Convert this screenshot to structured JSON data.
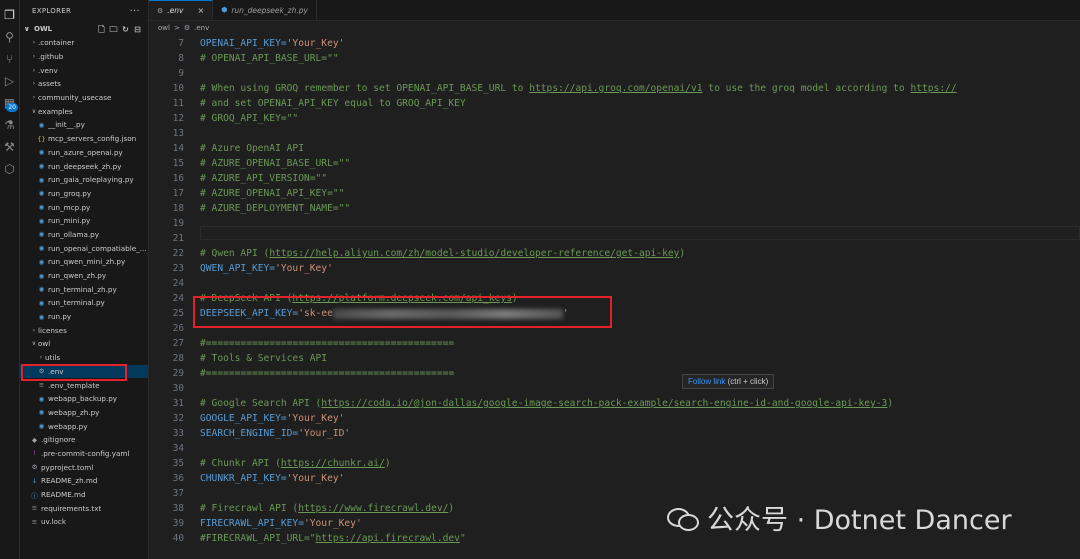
{
  "activity_bar": {
    "icons": [
      "explorer-icon",
      "search-icon",
      "source-control-icon",
      "run-debug-icon",
      "extensions-icon",
      "testing-icon",
      "remote-icon",
      "docker-icon"
    ],
    "extensions_badge": "20"
  },
  "sidebar": {
    "title": "EXPLORER",
    "more": "···",
    "root": "OWL",
    "items": [
      {
        "label": ".container",
        "type": "folder",
        "expanded": false,
        "depth": 1
      },
      {
        "label": ".github",
        "type": "folder",
        "expanded": false,
        "depth": 1
      },
      {
        "label": ".venv",
        "type": "folder",
        "expanded": false,
        "depth": 1
      },
      {
        "label": "assets",
        "type": "folder",
        "expanded": false,
        "depth": 1
      },
      {
        "label": "community_usecase",
        "type": "folder",
        "expanded": false,
        "depth": 1
      },
      {
        "label": "examples",
        "type": "folder",
        "expanded": true,
        "depth": 1
      },
      {
        "label": "__init__.py",
        "type": "py",
        "depth": 2
      },
      {
        "label": "mcp_servers_config.json",
        "type": "json",
        "depth": 2
      },
      {
        "label": "run_azure_openai.py",
        "type": "py",
        "depth": 2
      },
      {
        "label": "run_deepseek_zh.py",
        "type": "py",
        "depth": 2
      },
      {
        "label": "run_gaia_roleplaying.py",
        "type": "py",
        "depth": 2
      },
      {
        "label": "run_groq.py",
        "type": "py",
        "depth": 2
      },
      {
        "label": "run_mcp.py",
        "type": "py",
        "depth": 2
      },
      {
        "label": "run_mini.py",
        "type": "py",
        "depth": 2
      },
      {
        "label": "run_ollama.py",
        "type": "py",
        "depth": 2
      },
      {
        "label": "run_openai_compatiable_...",
        "type": "py",
        "depth": 2
      },
      {
        "label": "run_qwen_mini_zh.py",
        "type": "py",
        "depth": 2
      },
      {
        "label": "run_qwen_zh.py",
        "type": "py",
        "depth": 2
      },
      {
        "label": "run_terminal_zh.py",
        "type": "py",
        "depth": 2
      },
      {
        "label": "run_terminal.py",
        "type": "py",
        "depth": 2
      },
      {
        "label": "run.py",
        "type": "py",
        "depth": 2
      },
      {
        "label": "licenses",
        "type": "folder",
        "expanded": false,
        "depth": 1
      },
      {
        "label": "owl",
        "type": "folder",
        "expanded": true,
        "depth": 1
      },
      {
        "label": "utils",
        "type": "folder",
        "expanded": false,
        "depth": 2
      },
      {
        "label": ".env",
        "type": "gear",
        "depth": 2,
        "selected": true
      },
      {
        "label": ".env_template",
        "type": "txt",
        "depth": 2
      },
      {
        "label": "webapp_backup.py",
        "type": "py",
        "depth": 2
      },
      {
        "label": "webapp_zh.py",
        "type": "py",
        "depth": 2
      },
      {
        "label": "webapp.py",
        "type": "py",
        "depth": 2
      },
      {
        "label": ".gitignore",
        "type": "git",
        "depth": 1
      },
      {
        "label": ".pre-commit-config.yaml",
        "type": "yaml",
        "depth": 1
      },
      {
        "label": "pyproject.toml",
        "type": "toml",
        "depth": 1
      },
      {
        "label": "README_zh.md",
        "type": "md",
        "depth": 1
      },
      {
        "label": "README.md",
        "type": "info",
        "depth": 1
      },
      {
        "label": "requirements.txt",
        "type": "txt",
        "depth": 1
      },
      {
        "label": "uv.lock",
        "type": "lock",
        "depth": 1
      }
    ]
  },
  "tabs": [
    {
      "label": ".env",
      "icon": "gear-icon",
      "active": true,
      "close": "×"
    },
    {
      "label": "run_deepseek_zh.py",
      "icon": "python-file-icon",
      "active": false
    }
  ],
  "breadcrumb": {
    "root": "owl",
    "sep": ">",
    "file": ".env"
  },
  "editor": {
    "lines": [
      {
        "n": "7",
        "parts": [
          [
            "key",
            "OPENAI_API_KEY="
          ],
          [
            "str",
            "'Your_Key'"
          ]
        ]
      },
      {
        "n": "8",
        "parts": [
          [
            "comment",
            "# OPENAI_API_BASE_URL=\"\""
          ]
        ]
      },
      {
        "n": "9",
        "parts": []
      },
      {
        "n": "10",
        "parts": [
          [
            "comment",
            "# When using GROQ remember to set OPENAI_API_BASE_URL to "
          ],
          [
            "link",
            "https://api.groq.com/openai/v1"
          ],
          [
            "comment",
            " to use the groq model according to "
          ],
          [
            "link",
            "https://"
          ]
        ]
      },
      {
        "n": "11",
        "parts": [
          [
            "comment",
            "# and set OPENAI_API_KEY equal to GROQ_API_KEY"
          ]
        ]
      },
      {
        "n": "12",
        "parts": [
          [
            "comment",
            "# GROQ_API_KEY=\"\""
          ]
        ]
      },
      {
        "n": "13",
        "parts": []
      },
      {
        "n": "14",
        "parts": [
          [
            "comment",
            "# Azure OpenAI API"
          ]
        ]
      },
      {
        "n": "15",
        "parts": [
          [
            "comment",
            "# AZURE_OPENAI_BASE_URL=\"\""
          ]
        ]
      },
      {
        "n": "16",
        "parts": [
          [
            "comment",
            "# AZURE_API_VERSION=\"\""
          ]
        ]
      },
      {
        "n": "17",
        "parts": [
          [
            "comment",
            "# AZURE_OPENAI_API_KEY=\"\""
          ]
        ]
      },
      {
        "n": "18",
        "parts": [
          [
            "comment",
            "# AZURE_DEPLOYMENT_NAME=\"\""
          ]
        ]
      },
      {
        "n": "19",
        "parts": []
      },
      {
        "n": "21",
        "parts": []
      },
      {
        "n": "22",
        "parts": [
          [
            "comment",
            "# Qwen API ("
          ],
          [
            "link",
            "https://help.aliyun.com/zh/model-studio/developer-reference/get-api-key"
          ],
          [
            "comment",
            ")"
          ]
        ]
      },
      {
        "n": "23",
        "parts": [
          [
            "key",
            "QWEN_API_KEY="
          ],
          [
            "str",
            "'Your_Key'"
          ]
        ]
      },
      {
        "n": "24",
        "parts": []
      },
      {
        "n": "24",
        "parts": [
          [
            "comment",
            "# DeepSeek API ("
          ],
          [
            "link",
            "https://platform.deepseek.com/api_keys"
          ],
          [
            "comment",
            ")"
          ]
        ]
      },
      {
        "n": "25",
        "parts": [
          [
            "key",
            "DEEPSEEK_API_KEY="
          ],
          [
            "str",
            "'sk-ee"
          ],
          [
            "blur",
            ""
          ],
          [
            "str",
            "'"
          ]
        ]
      },
      {
        "n": "26",
        "parts": []
      },
      {
        "n": "27",
        "parts": [
          [
            "comment",
            "#==========================================="
          ]
        ]
      },
      {
        "n": "28",
        "parts": [
          [
            "comment",
            "# Tools & Services API"
          ]
        ]
      },
      {
        "n": "29",
        "parts": [
          [
            "comment",
            "#==========================================="
          ]
        ]
      },
      {
        "n": "30",
        "parts": []
      },
      {
        "n": "31",
        "parts": [
          [
            "comment",
            "# Google Search API ("
          ],
          [
            "link",
            "https://coda.io/@jon-dallas/google-image-search-pack-example/search-engine-id-and-google-api-key-3"
          ],
          [
            "comment",
            ")"
          ]
        ]
      },
      {
        "n": "32",
        "parts": [
          [
            "key",
            "GOOGLE_API_KEY="
          ],
          [
            "str",
            "'Your_Key'"
          ]
        ]
      },
      {
        "n": "33",
        "parts": [
          [
            "key",
            "SEARCH_ENGINE_ID="
          ],
          [
            "str",
            "'Your_ID'"
          ]
        ]
      },
      {
        "n": "34",
        "parts": []
      },
      {
        "n": "35",
        "parts": [
          [
            "comment",
            "# Chunkr API ("
          ],
          [
            "link",
            "https://chunkr.ai/"
          ],
          [
            "comment",
            ")"
          ]
        ]
      },
      {
        "n": "36",
        "parts": [
          [
            "key",
            "CHUNKR_API_KEY="
          ],
          [
            "str",
            "'Your_Key'"
          ]
        ]
      },
      {
        "n": "37",
        "parts": []
      },
      {
        "n": "38",
        "parts": [
          [
            "comment",
            "# Firecrawl API ("
          ],
          [
            "link",
            "https://www.firecrawl.dev/"
          ],
          [
            "comment",
            ")"
          ]
        ]
      },
      {
        "n": "39",
        "parts": [
          [
            "key",
            "FIRECRAWL_API_KEY="
          ],
          [
            "str",
            "'Your_Key'"
          ]
        ]
      },
      {
        "n": "40",
        "parts": [
          [
            "comment",
            "#FIRECRAWL_API_URL=\""
          ],
          [
            "link",
            "https://api.firecrawl.dev"
          ],
          [
            "comment",
            "\""
          ]
        ]
      }
    ]
  },
  "tooltip": {
    "link": "Follow link",
    "hint": " (ctrl + click)"
  },
  "watermark": {
    "text": "公众号 · Dotnet Dancer"
  },
  "colors": {
    "highlight_box": "#e3232b",
    "accent": "#0078d4"
  }
}
